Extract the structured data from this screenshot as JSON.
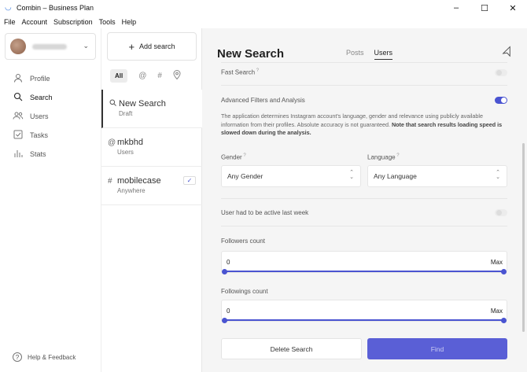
{
  "window": {
    "title": "Combin – Business Plan",
    "minimize": "–",
    "maximize": "☐",
    "close": "✕"
  },
  "menubar": [
    "File",
    "Account",
    "Subscription",
    "Tools",
    "Help"
  ],
  "sidebar": {
    "nav": [
      {
        "label": "Profile",
        "icon": "person-icon"
      },
      {
        "label": "Search",
        "icon": "search-icon"
      },
      {
        "label": "Users",
        "icon": "users-icon"
      },
      {
        "label": "Tasks",
        "icon": "tasks-icon"
      },
      {
        "label": "Stats",
        "icon": "stats-icon"
      }
    ],
    "help_label": "Help & Feedback"
  },
  "searches": {
    "add_label": "Add search",
    "filters": {
      "all": "All",
      "at": "@",
      "hash": "#",
      "pin": "⌖"
    },
    "items": [
      {
        "icon": "search-icon",
        "title": "New Search",
        "sub": "Draft",
        "active": true
      },
      {
        "icon": "at-icon",
        "title": "mkbhd",
        "sub": "Users"
      },
      {
        "icon": "hash-icon",
        "title": "mobilecase",
        "sub": "Anywhere",
        "checked": true
      }
    ]
  },
  "main": {
    "title": "New Search",
    "tabs": [
      {
        "label": "Posts"
      },
      {
        "label": "Users",
        "active": true
      }
    ],
    "fast_search": {
      "label": "Fast Search",
      "on": false
    },
    "advanced": {
      "label": "Advanced Filters and Analysis",
      "on": true,
      "desc_plain": "The application determines Instagram account's language, gender and relevance using publicly available information from their profiles. Absolute accuracy is not guaranteed.",
      "desc_bold": "Note that search results loading speed is slowed down during the analysis."
    },
    "gender": {
      "label": "Gender",
      "value": "Any Gender"
    },
    "language": {
      "label": "Language",
      "value": "Any Language"
    },
    "active_last_week": {
      "label": "User had to be active last week",
      "on": false
    },
    "followers": {
      "label": "Followers count",
      "min": "0",
      "max": "Max"
    },
    "followings": {
      "label": "Followings count",
      "min": "0",
      "max": "Max"
    },
    "delete_label": "Delete Search",
    "find_label": "Find"
  },
  "colors": {
    "accent": "#4a54d1"
  }
}
